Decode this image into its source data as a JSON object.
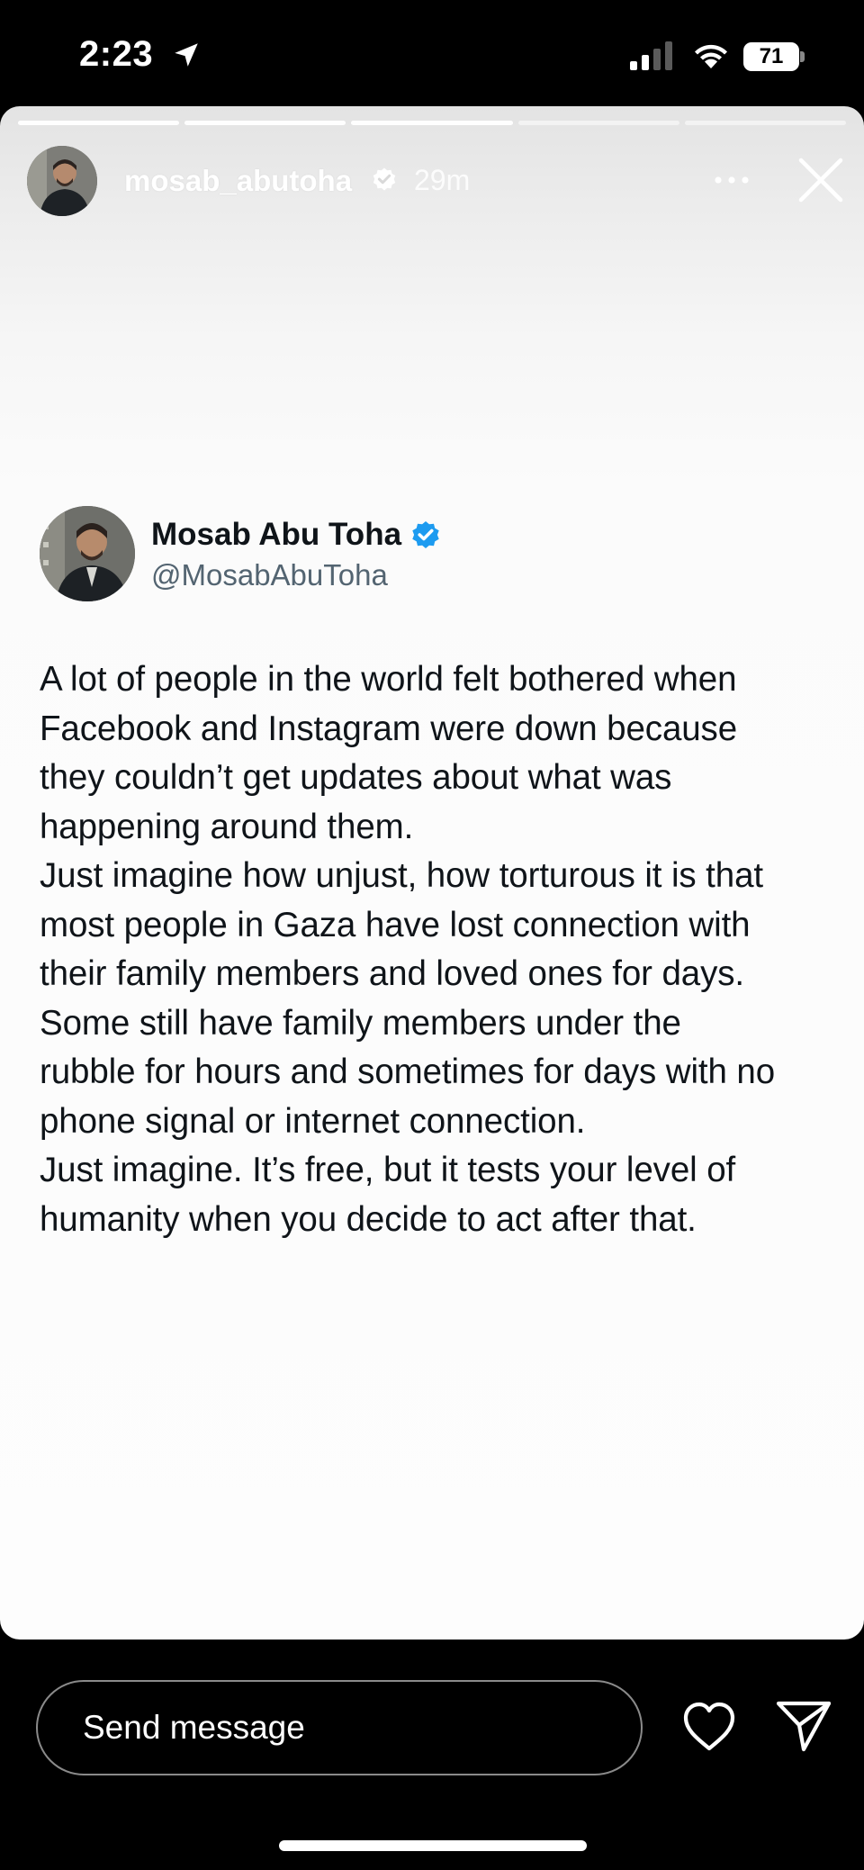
{
  "status_bar": {
    "time": "2:23",
    "battery_level": "71",
    "icons": [
      "location-arrow-icon",
      "cellular-signal-icon",
      "wifi-icon",
      "battery-icon"
    ]
  },
  "story": {
    "progress_segments": 5,
    "completed_segments": 3,
    "username": "mosab_abutoha",
    "time_ago": "29m",
    "verified": true,
    "icons": [
      "more-options-icon",
      "close-icon",
      "verified-badge-icon"
    ]
  },
  "tweet": {
    "display_name": "Mosab Abu Toha",
    "handle": "@MosabAbuToha",
    "verified_color": "#1d9bf0",
    "lines": [
      "A lot of people in the world felt bothered when",
      "Facebook and Instagram were down because",
      "they couldn’t get updates about what was",
      "happening around them.",
      "Just imagine how unjust, how torturous it is that",
      "most people in Gaza have lost connection with",
      "their family members and loved ones for days.",
      "Some still have family members under the",
      "rubble for hours and sometimes for days with no",
      "phone signal or internet connection.",
      "Just imagine. It’s free, but it tests your level of",
      "humanity when you decide to act after that."
    ]
  },
  "bottom_bar": {
    "message_placeholder": "Send message",
    "icons": [
      "heart-icon",
      "send-icon"
    ]
  }
}
